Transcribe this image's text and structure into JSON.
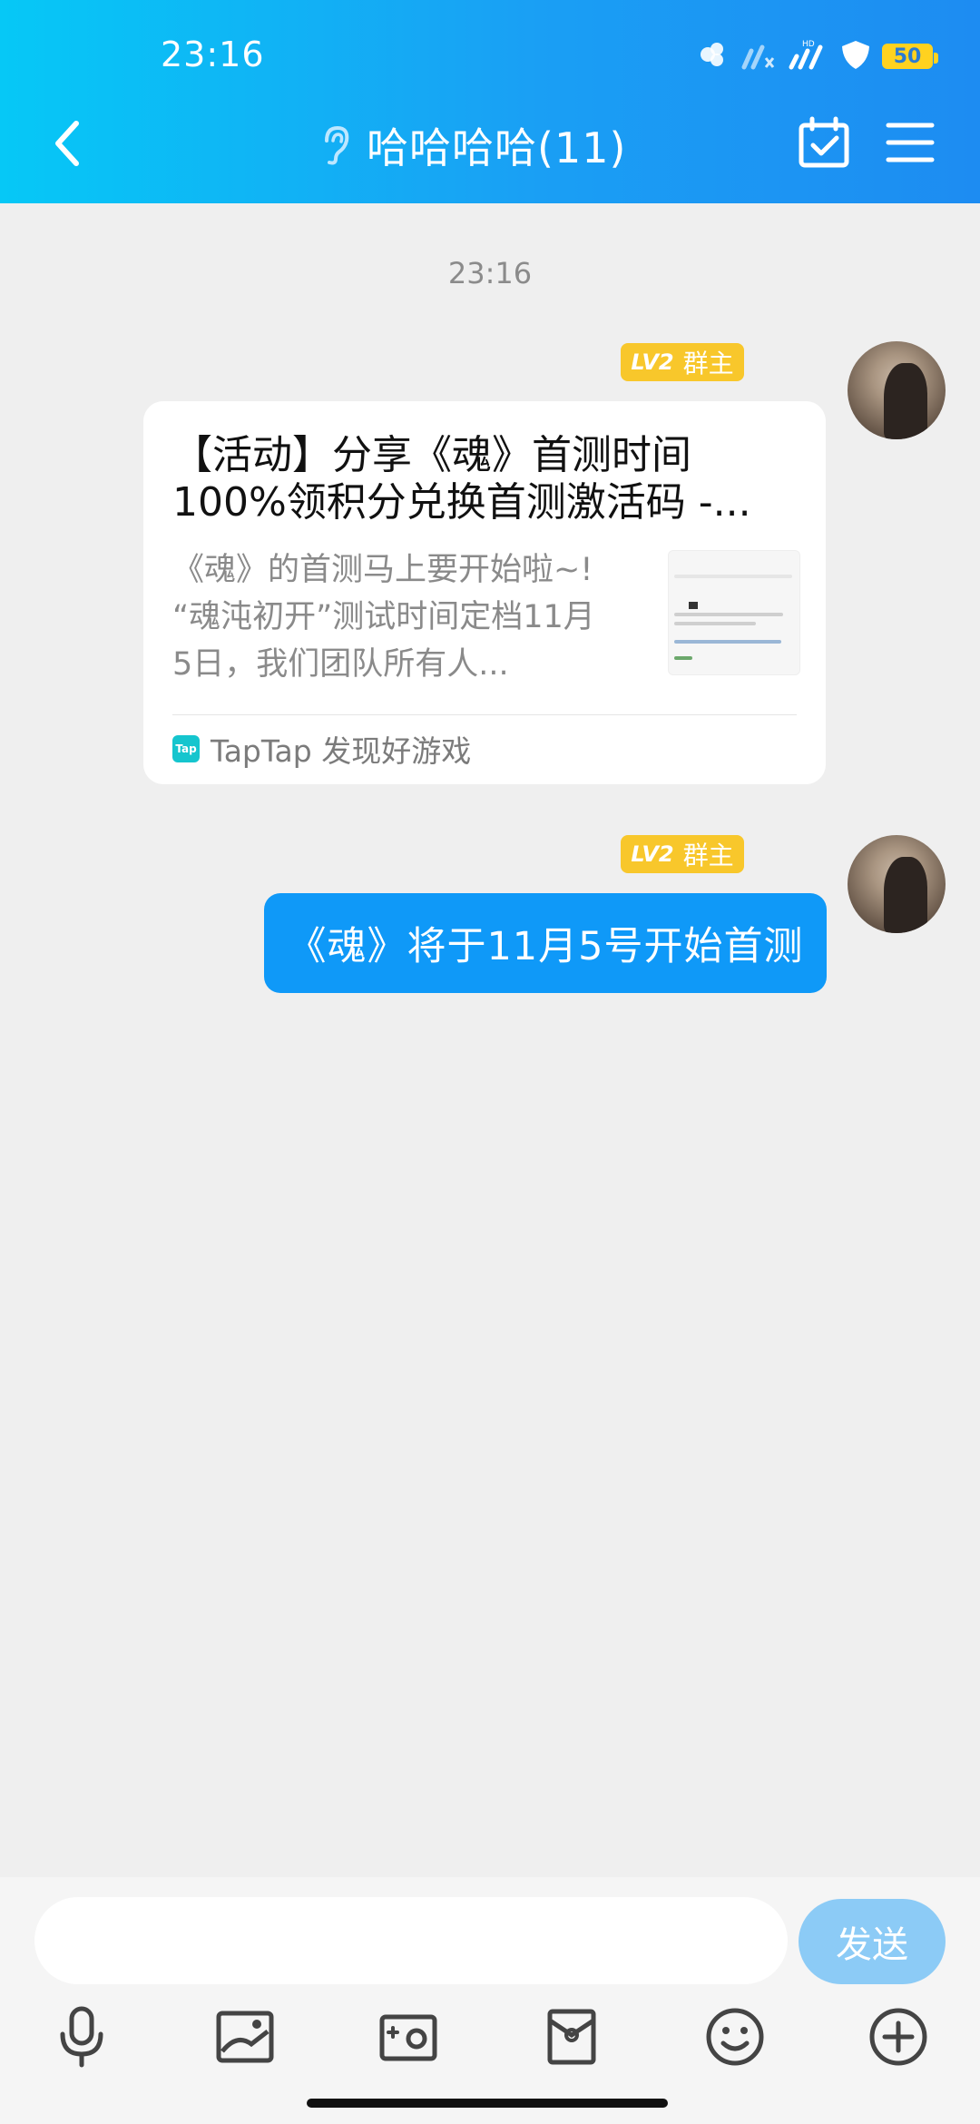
{
  "status_bar": {
    "time": "23:16",
    "battery": "50"
  },
  "header": {
    "title": "哈哈哈哈(11)",
    "back_icon": "chevron-left-icon",
    "ear_icon": "ear-icon",
    "calendar_icon": "calendar-check-icon",
    "menu_icon": "menu-icon"
  },
  "chat": {
    "timestamp": "23:16",
    "messages": [
      {
        "type": "link_card",
        "badge_level": "LV2",
        "badge_role": "群主",
        "title_line1": "【活动】分享《魂》首测时间",
        "title_line2": "100%领积分兑换首测激活码 -...",
        "desc_line1": "《魂》的首测马上要开始啦~!",
        "desc_line2": "“魂沌初开”测试时间定档11月",
        "desc_line3": "5日，我们团队所有人...",
        "source_logo": "Tap",
        "source": "TapTap 发现好游戏"
      },
      {
        "type": "text",
        "badge_level": "LV2",
        "badge_role": "群主",
        "text": "《魂》将于11月5号开始首测"
      }
    ]
  },
  "input": {
    "placeholder": "",
    "value": "",
    "send_label": "发送"
  },
  "toolbar": {
    "icons": [
      "microphone-icon",
      "image-icon",
      "camera-icon",
      "red-packet-icon",
      "emoji-icon",
      "plus-icon"
    ]
  },
  "colors": {
    "header_gradient_start": "#06c8f6",
    "header_gradient_end": "#1d8cf2",
    "bubble_blue": "#0f99f8",
    "badge_yellow": "#f8c72b",
    "send_button": "#8ccbf6",
    "background": "#efefef"
  }
}
